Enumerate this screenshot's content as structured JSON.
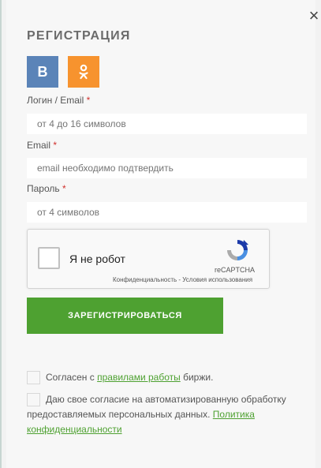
{
  "modal": {
    "title": "РЕГИСТРАЦИЯ",
    "close_label": "×"
  },
  "social": {
    "vk_label": "В",
    "ok_label": "ок"
  },
  "fields": {
    "login": {
      "label": "Логин / Email",
      "required_mark": "*",
      "placeholder": "от 4 до 16 символов"
    },
    "email": {
      "label": "Email",
      "required_mark": "*",
      "placeholder": "email необходимо подтвердить"
    },
    "password": {
      "label": "Пароль",
      "required_mark": "*",
      "placeholder": "от 4 символов"
    }
  },
  "captcha": {
    "label": "Я не робот",
    "brand": "reCAPTCHA",
    "links": "Конфиденциальность - Условия использования"
  },
  "submit_label": "ЗАРЕГИСТРИРОВАТЬСЯ",
  "agreements": {
    "rules": {
      "prefix": "Согласен с ",
      "link": "правилами работы",
      "suffix": " биржи."
    },
    "privacy": {
      "text": "Даю свое согласие на автоматизированную обработку предоставляемых персональных данных. ",
      "link": "Политика конфиденциальности"
    }
  },
  "colors": {
    "accent_green": "#4ea131",
    "vk_blue": "#5b84b8",
    "ok_orange": "#f7932e",
    "required_red": "#d0312d"
  }
}
